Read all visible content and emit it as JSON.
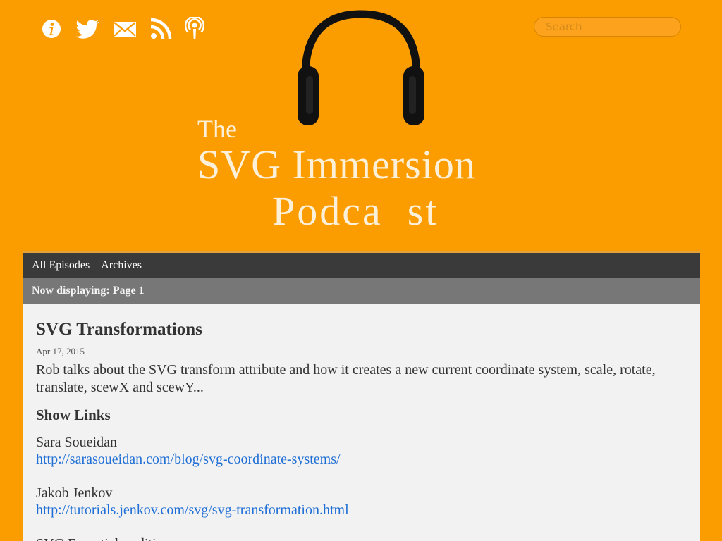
{
  "header": {
    "icons": [
      {
        "name": "info-icon"
      },
      {
        "name": "twitter-icon"
      },
      {
        "name": "mail-icon"
      },
      {
        "name": "rss-icon"
      },
      {
        "name": "podcast-icon"
      }
    ],
    "search_placeholder": "Search",
    "logo": {
      "the": "The",
      "name": "SVG Immersion",
      "podcast": "Podca  st"
    }
  },
  "nav": {
    "items": [
      {
        "label": "All Episodes"
      },
      {
        "label": "Archives"
      }
    ]
  },
  "subbar": {
    "text": "Now displaying: Page 1"
  },
  "post": {
    "title": "SVG Transformations",
    "date": "Apr 17, 2015",
    "summary": "Rob talks about the SVG transform attribute and how it creates a new current coordinate system, scale, rotate, translate, scewX and scewY...",
    "links_heading": "Show Links",
    "links": [
      {
        "name": "Sara Soueidan",
        "url": "http://sarasoueidan.com/blog/svg-coordinate-systems/"
      },
      {
        "name": "Jakob Jenkov",
        "url": "http://tutorials.jenkov.com/svg/svg-transformation.html"
      },
      {
        "name": "SVG Essentials, edition",
        "url": ""
      }
    ]
  },
  "colors": {
    "background": "#fb9c00",
    "nav_bar": "#3a3a3a",
    "sub_bar": "#777777",
    "panel": "#f2f2f2",
    "link": "#1f6fd6",
    "logo_text": "#fdf0d8"
  }
}
